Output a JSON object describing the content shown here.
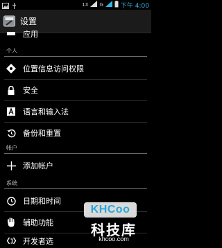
{
  "status_bar": {
    "time": "下午 4:00",
    "network_label_1": "1X",
    "network_label_2": "G"
  },
  "action_bar": {
    "title": "设置"
  },
  "sections": {
    "partial_item": "应用",
    "personal_header": "个人",
    "personal_items": [
      "位置信息访问权限",
      "安全",
      "语言和输入法",
      "备份和重置"
    ],
    "accounts_header": "帐户",
    "accounts_items": [
      "添加帐户"
    ],
    "system_header": "系统",
    "system_items": [
      "日期和时间",
      "辅助功能",
      "开发者选"
    ]
  },
  "watermark": {
    "logo": "KHCoo",
    "name": "科技库",
    "url": "khcoo.com"
  },
  "colors": {
    "accent": "#33b5e5",
    "background": "#000000",
    "header_text": "#bdbdbd"
  }
}
